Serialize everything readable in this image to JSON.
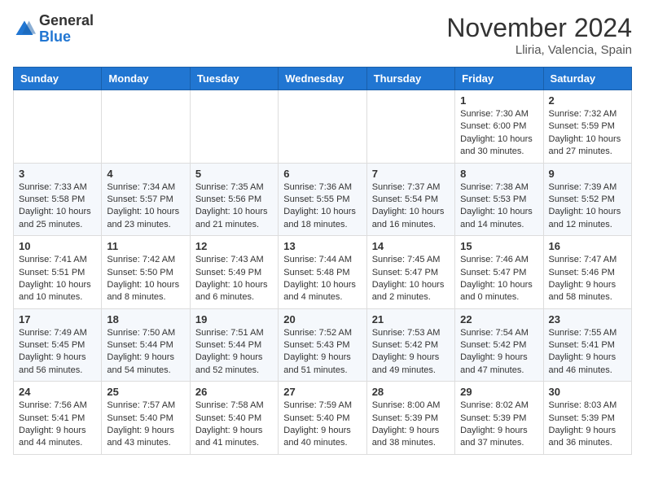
{
  "header": {
    "logo_general": "General",
    "logo_blue": "Blue",
    "month_title": "November 2024",
    "location": "Lliria, Valencia, Spain"
  },
  "days_of_week": [
    "Sunday",
    "Monday",
    "Tuesday",
    "Wednesday",
    "Thursday",
    "Friday",
    "Saturday"
  ],
  "weeks": [
    [
      {
        "day": "",
        "info": ""
      },
      {
        "day": "",
        "info": ""
      },
      {
        "day": "",
        "info": ""
      },
      {
        "day": "",
        "info": ""
      },
      {
        "day": "",
        "info": ""
      },
      {
        "day": "1",
        "info": "Sunrise: 7:30 AM\nSunset: 6:00 PM\nDaylight: 10 hours and 30 minutes."
      },
      {
        "day": "2",
        "info": "Sunrise: 7:32 AM\nSunset: 5:59 PM\nDaylight: 10 hours and 27 minutes."
      }
    ],
    [
      {
        "day": "3",
        "info": "Sunrise: 7:33 AM\nSunset: 5:58 PM\nDaylight: 10 hours and 25 minutes."
      },
      {
        "day": "4",
        "info": "Sunrise: 7:34 AM\nSunset: 5:57 PM\nDaylight: 10 hours and 23 minutes."
      },
      {
        "day": "5",
        "info": "Sunrise: 7:35 AM\nSunset: 5:56 PM\nDaylight: 10 hours and 21 minutes."
      },
      {
        "day": "6",
        "info": "Sunrise: 7:36 AM\nSunset: 5:55 PM\nDaylight: 10 hours and 18 minutes."
      },
      {
        "day": "7",
        "info": "Sunrise: 7:37 AM\nSunset: 5:54 PM\nDaylight: 10 hours and 16 minutes."
      },
      {
        "day": "8",
        "info": "Sunrise: 7:38 AM\nSunset: 5:53 PM\nDaylight: 10 hours and 14 minutes."
      },
      {
        "day": "9",
        "info": "Sunrise: 7:39 AM\nSunset: 5:52 PM\nDaylight: 10 hours and 12 minutes."
      }
    ],
    [
      {
        "day": "10",
        "info": "Sunrise: 7:41 AM\nSunset: 5:51 PM\nDaylight: 10 hours and 10 minutes."
      },
      {
        "day": "11",
        "info": "Sunrise: 7:42 AM\nSunset: 5:50 PM\nDaylight: 10 hours and 8 minutes."
      },
      {
        "day": "12",
        "info": "Sunrise: 7:43 AM\nSunset: 5:49 PM\nDaylight: 10 hours and 6 minutes."
      },
      {
        "day": "13",
        "info": "Sunrise: 7:44 AM\nSunset: 5:48 PM\nDaylight: 10 hours and 4 minutes."
      },
      {
        "day": "14",
        "info": "Sunrise: 7:45 AM\nSunset: 5:47 PM\nDaylight: 10 hours and 2 minutes."
      },
      {
        "day": "15",
        "info": "Sunrise: 7:46 AM\nSunset: 5:47 PM\nDaylight: 10 hours and 0 minutes."
      },
      {
        "day": "16",
        "info": "Sunrise: 7:47 AM\nSunset: 5:46 PM\nDaylight: 9 hours and 58 minutes."
      }
    ],
    [
      {
        "day": "17",
        "info": "Sunrise: 7:49 AM\nSunset: 5:45 PM\nDaylight: 9 hours and 56 minutes."
      },
      {
        "day": "18",
        "info": "Sunrise: 7:50 AM\nSunset: 5:44 PM\nDaylight: 9 hours and 54 minutes."
      },
      {
        "day": "19",
        "info": "Sunrise: 7:51 AM\nSunset: 5:44 PM\nDaylight: 9 hours and 52 minutes."
      },
      {
        "day": "20",
        "info": "Sunrise: 7:52 AM\nSunset: 5:43 PM\nDaylight: 9 hours and 51 minutes."
      },
      {
        "day": "21",
        "info": "Sunrise: 7:53 AM\nSunset: 5:42 PM\nDaylight: 9 hours and 49 minutes."
      },
      {
        "day": "22",
        "info": "Sunrise: 7:54 AM\nSunset: 5:42 PM\nDaylight: 9 hours and 47 minutes."
      },
      {
        "day": "23",
        "info": "Sunrise: 7:55 AM\nSunset: 5:41 PM\nDaylight: 9 hours and 46 minutes."
      }
    ],
    [
      {
        "day": "24",
        "info": "Sunrise: 7:56 AM\nSunset: 5:41 PM\nDaylight: 9 hours and 44 minutes."
      },
      {
        "day": "25",
        "info": "Sunrise: 7:57 AM\nSunset: 5:40 PM\nDaylight: 9 hours and 43 minutes."
      },
      {
        "day": "26",
        "info": "Sunrise: 7:58 AM\nSunset: 5:40 PM\nDaylight: 9 hours and 41 minutes."
      },
      {
        "day": "27",
        "info": "Sunrise: 7:59 AM\nSunset: 5:40 PM\nDaylight: 9 hours and 40 minutes."
      },
      {
        "day": "28",
        "info": "Sunrise: 8:00 AM\nSunset: 5:39 PM\nDaylight: 9 hours and 38 minutes."
      },
      {
        "day": "29",
        "info": "Sunrise: 8:02 AM\nSunset: 5:39 PM\nDaylight: 9 hours and 37 minutes."
      },
      {
        "day": "30",
        "info": "Sunrise: 8:03 AM\nSunset: 5:39 PM\nDaylight: 9 hours and 36 minutes."
      }
    ]
  ]
}
